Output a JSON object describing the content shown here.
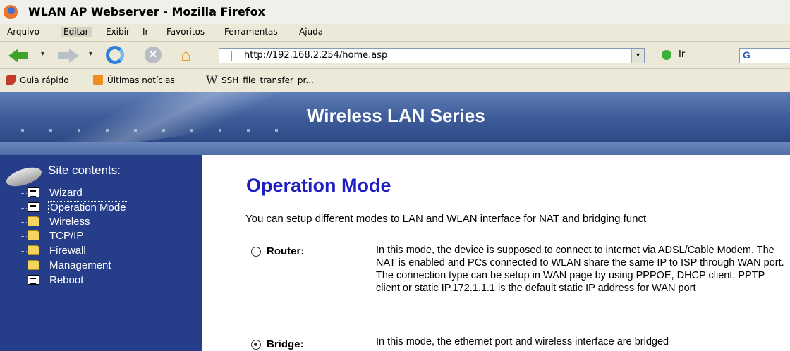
{
  "window": {
    "title": "WLAN AP Webserver - Mozilla Firefox"
  },
  "menu": [
    "Arquivo",
    "Editar",
    "Exibir",
    "Ir",
    "Favoritos",
    "Ferramentas",
    "Ajuda"
  ],
  "nav": {
    "url": "http://192.168.2.254/home.asp",
    "go_label": "Ir",
    "search_prefix": "G"
  },
  "bookmarks": [
    "Guia rápido",
    "Últimas notícias",
    "SSH_file_transfer_pr..."
  ],
  "banner": {
    "title": "Wireless LAN Series"
  },
  "sidebar": {
    "title": "Site contents:",
    "items": [
      {
        "label": "Wizard",
        "icon": "doc"
      },
      {
        "label": "Operation Mode",
        "icon": "doc"
      },
      {
        "label": "Wireless",
        "icon": "folder"
      },
      {
        "label": "TCP/IP",
        "icon": "folder"
      },
      {
        "label": "Firewall",
        "icon": "folder"
      },
      {
        "label": "Management",
        "icon": "folder"
      },
      {
        "label": "Reboot",
        "icon": "doc"
      }
    ],
    "selected": "Operation Mode"
  },
  "main": {
    "heading": "Operation Mode",
    "intro": "You can setup different modes to LAN and WLAN interface for NAT and bridging funct",
    "modes": [
      {
        "label": "Router:",
        "checked": false,
        "description": "In this mode, the device is supposed to connect to internet via ADSL/Cable Modem. The NAT is enabled and PCs connected to WLAN share the same IP to ISP through WAN port. The connection type can be setup in WAN page by using PPPOE, DHCP client, PPTP client or static IP.172.1.1.1 is the default static IP address for WAN port"
      },
      {
        "label": "Bridge:",
        "checked": true,
        "description": "In this mode, the ethernet port and wireless interface are bridged"
      }
    ]
  }
}
